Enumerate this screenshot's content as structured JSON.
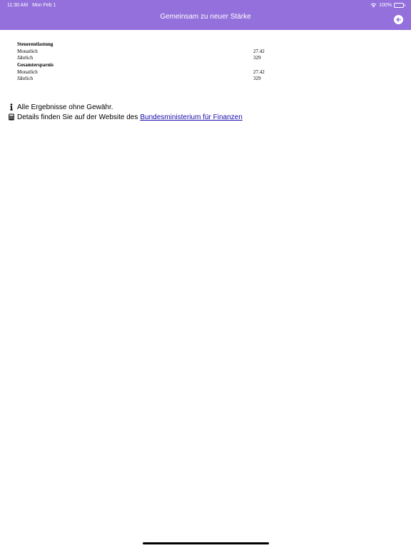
{
  "status_bar": {
    "time": "11:30 AM",
    "date": "Mon Feb 1",
    "battery": "100%"
  },
  "nav": {
    "title": "Gemeinsam zu neuer Stärke",
    "back_icon": "arrow-left-circle-icon"
  },
  "results": {
    "sections": [
      {
        "heading": "Steuerentlastung",
        "rows": [
          {
            "label": "Monatlich",
            "value": "27.42"
          },
          {
            "label": "Jährlich",
            "value": "329"
          }
        ]
      },
      {
        "heading": "Gesamtersparnis",
        "rows": [
          {
            "label": "Monatlich",
            "value": "27.42"
          },
          {
            "label": "Jährlich",
            "value": "329"
          }
        ]
      }
    ]
  },
  "info": {
    "disclaimer": "Alle Ergebnisse ohne Gewähr.",
    "details_prefix": "Details finden Sie auf der Website des",
    "details_link": "Bundesministerium für Finanzen"
  },
  "colors": {
    "header": "#9370db",
    "link": "#1a0dab"
  }
}
